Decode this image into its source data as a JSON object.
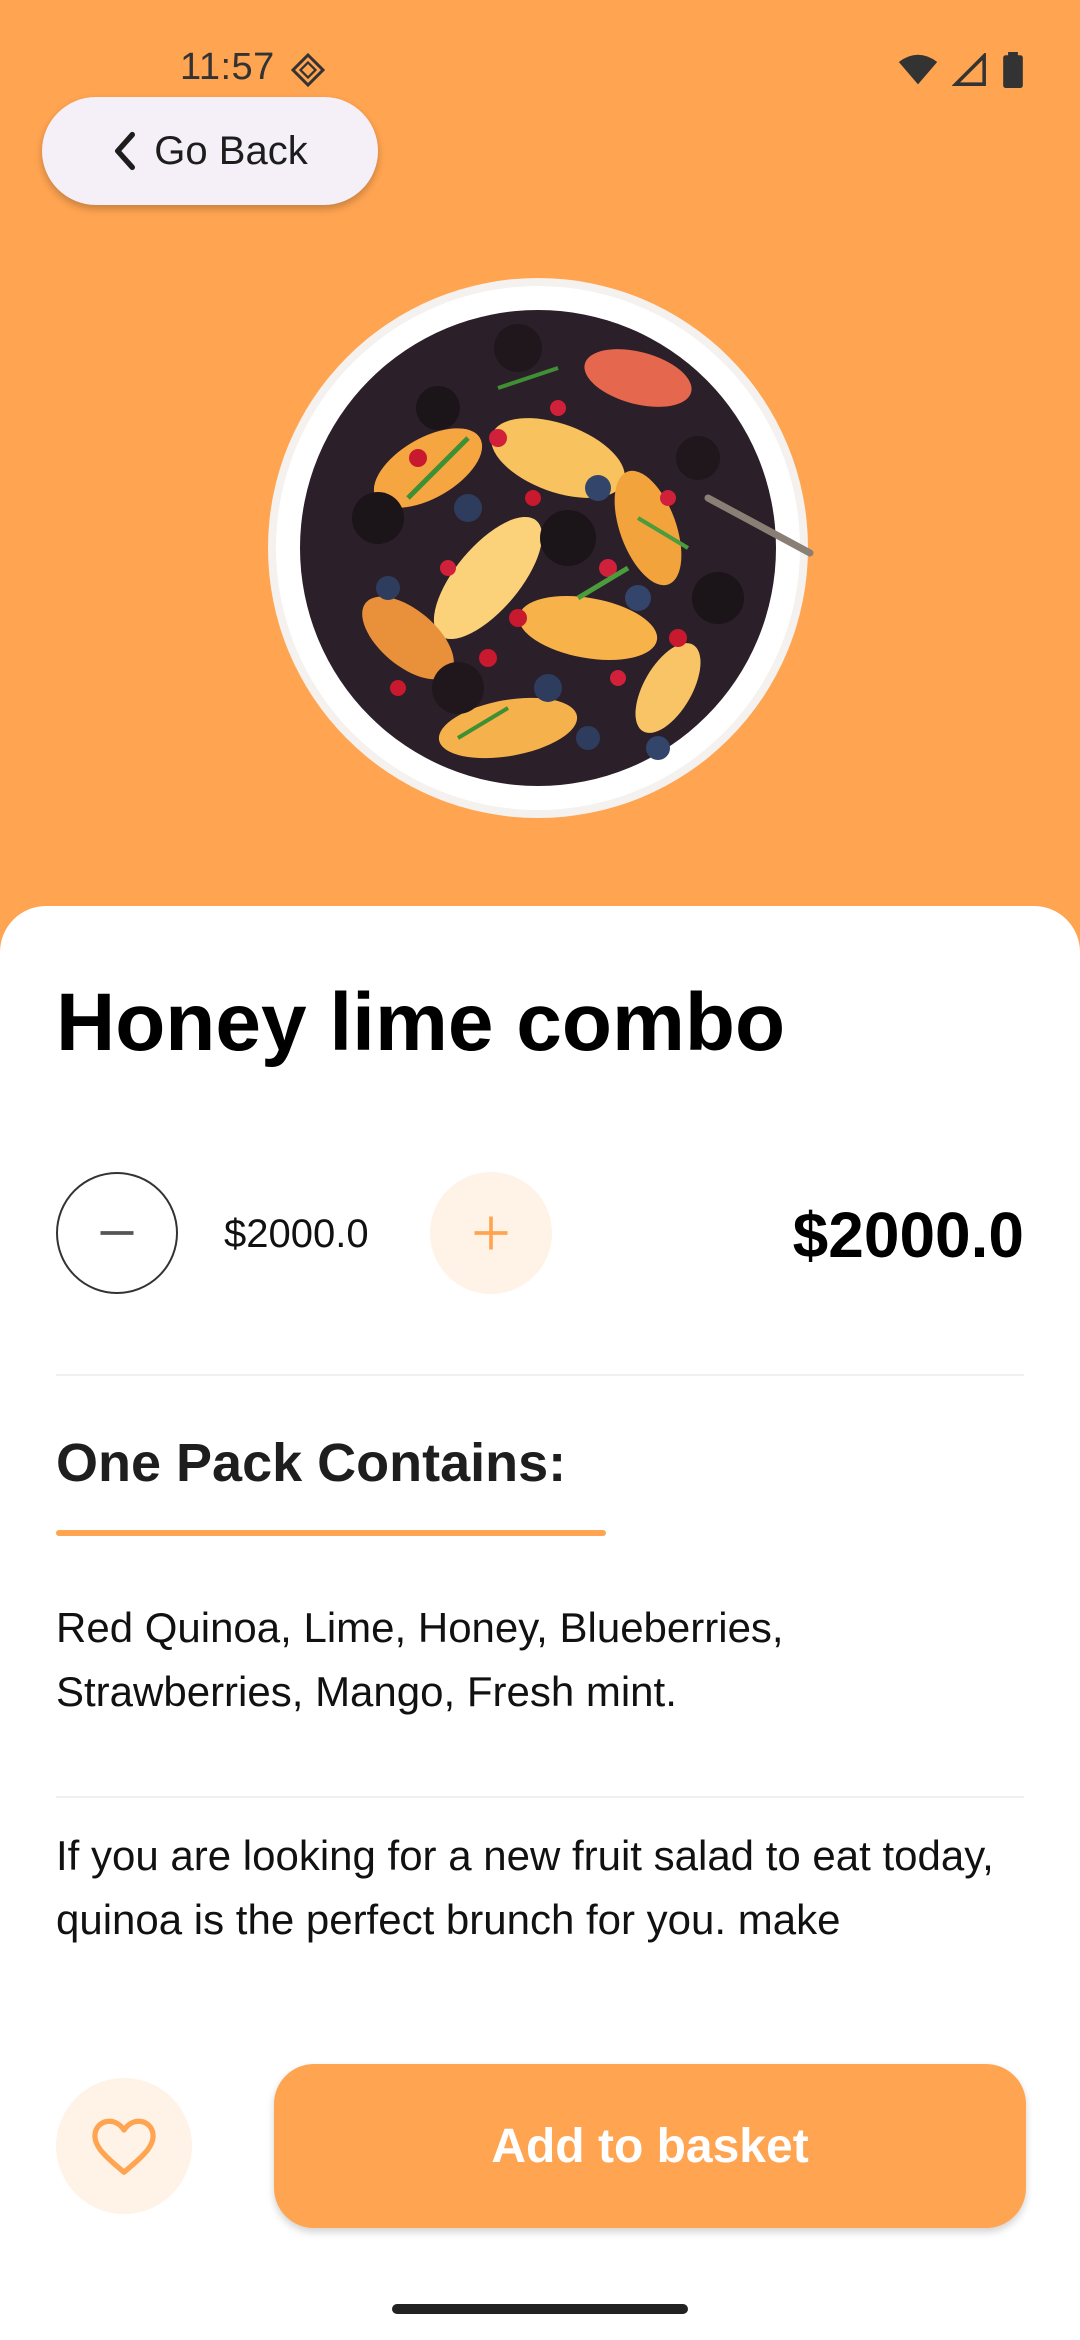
{
  "status_bar": {
    "time": "11:57"
  },
  "header": {
    "back_label": "Go Back"
  },
  "product": {
    "title": "Honey lime combo",
    "unit_price": "$2000.0",
    "total_price": "$2000.0",
    "image_icon": "fruit-salad-bowl-image"
  },
  "contents": {
    "heading": "One Pack Contains:",
    "items": "Red Quinoa, Lime, Honey, Blueberries, Strawberries, Mango, Fresh mint."
  },
  "description": "If you are looking for a new fruit salad to eat today, quinoa is the perfect brunch for you. make",
  "actions": {
    "add_label": "Add to basket"
  },
  "colors": {
    "accent": "#ffa451",
    "accent_light": "#fff2e7",
    "surface": "#ffffff"
  }
}
